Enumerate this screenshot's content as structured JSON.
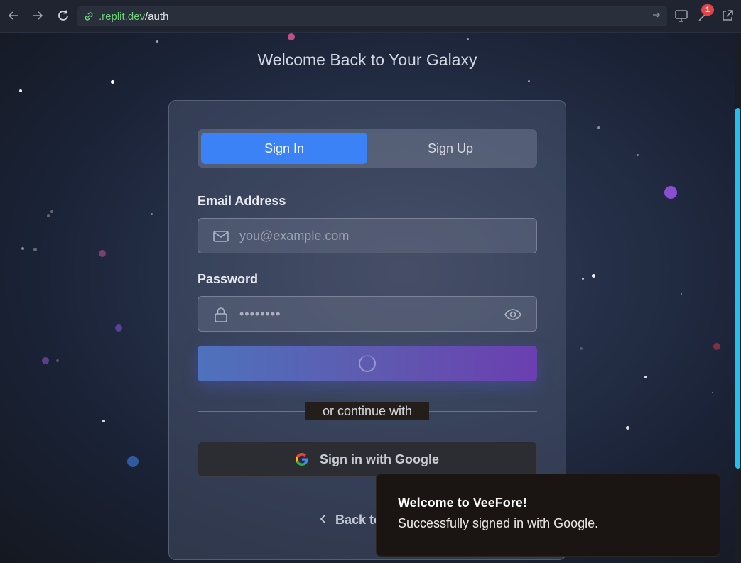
{
  "browser": {
    "url_host": ".replit.dev",
    "url_path": "/auth",
    "notification_count": "1"
  },
  "page": {
    "subtitle": "Welcome Back to Your Galaxy",
    "tabs": [
      {
        "label": "Sign In",
        "active": true
      },
      {
        "label": "Sign Up",
        "active": false
      }
    ],
    "email": {
      "label": "Email Address",
      "placeholder": "you@example.com"
    },
    "password": {
      "label": "Password",
      "value": "••••••••"
    },
    "divider_text": "or continue with",
    "google_button": "Sign in with Google",
    "back_link": "Back to"
  },
  "toast": {
    "title": "Welcome to VeeFore!",
    "message": "Successfully signed in with Google."
  },
  "colors": {
    "accent_blue": "#3b82f6",
    "scroll_thumb": "#22c0f0",
    "gradient_start": "#4e72bd",
    "gradient_end": "#6a3fb0"
  }
}
